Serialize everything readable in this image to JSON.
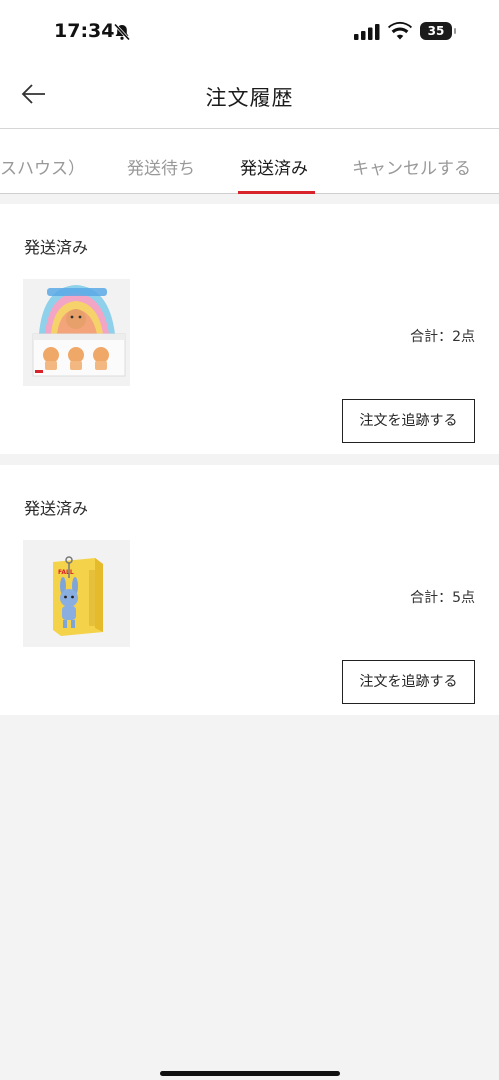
{
  "status_bar": {
    "time": "17:34",
    "battery": "35"
  },
  "header": {
    "title": "注文履歴"
  },
  "tabs": [
    {
      "label": "スハウス）",
      "active": false
    },
    {
      "label": "発送待ち",
      "active": false
    },
    {
      "label": "発送済み",
      "active": true
    },
    {
      "label": "キャンセルする",
      "active": false
    }
  ],
  "orders": [
    {
      "status": "発送済み",
      "total": "合計：2点",
      "track_label": "注文を追跡する"
    },
    {
      "status": "発送済み",
      "total": "合計：5点",
      "track_label": "注文を追跡する"
    }
  ],
  "colors": {
    "accent": "#d8232a",
    "background": "#f3f3f3"
  }
}
